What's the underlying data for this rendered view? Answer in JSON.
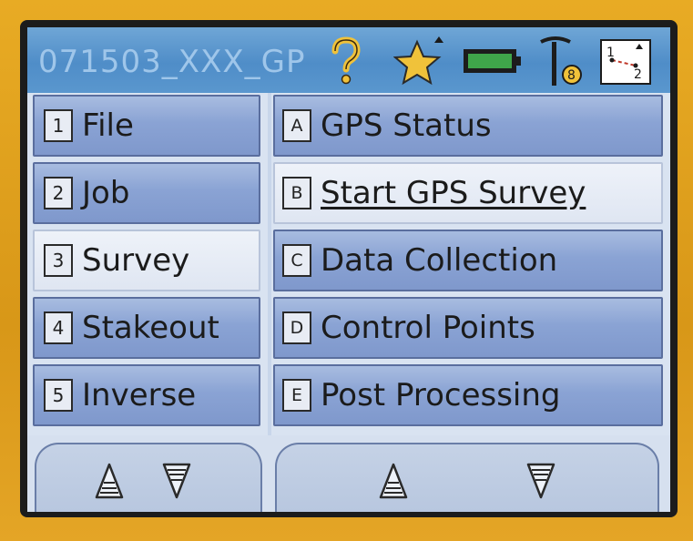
{
  "status_bar": {
    "job_name": "071503_XXX_GP",
    "icons": [
      "help-icon",
      "star-icon",
      "battery-icon",
      "gps-antenna-icon",
      "coordinate-icon"
    ]
  },
  "left_menu": [
    {
      "key": "1",
      "label": "File",
      "selected": false
    },
    {
      "key": "2",
      "label": "Job",
      "selected": false
    },
    {
      "key": "3",
      "label": "Survey",
      "selected": true
    },
    {
      "key": "4",
      "label": "Stakeout",
      "selected": false
    },
    {
      "key": "5",
      "label": "Inverse",
      "selected": false
    }
  ],
  "right_menu": [
    {
      "key": "A",
      "label": "GPS Status",
      "selected": false
    },
    {
      "key": "B",
      "label": "Start GPS Survey",
      "selected": true
    },
    {
      "key": "C",
      "label": "Data Collection",
      "selected": false
    },
    {
      "key": "D",
      "label": "Control Points",
      "selected": false
    },
    {
      "key": "E",
      "label": "Post Processing",
      "selected": false
    }
  ],
  "scroll": {
    "icons": [
      "scroll-up-icon",
      "scroll-down-icon"
    ]
  },
  "colors": {
    "bezel": "#e0a21c",
    "status_bar": "#5a97ce",
    "menu_item": "#8aa3d4",
    "selected_item": "#eef2f9"
  }
}
